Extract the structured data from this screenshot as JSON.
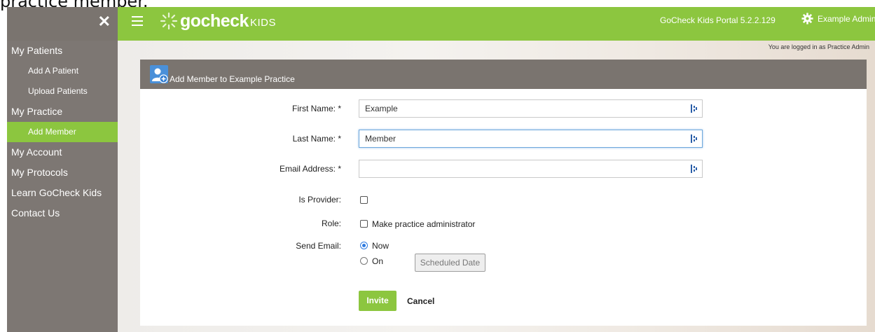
{
  "caption": "practice member.",
  "sidebar": {
    "items": [
      {
        "label": "My Patients"
      },
      {
        "label": "Add A Patient"
      },
      {
        "label": "Upload Patients"
      },
      {
        "label": "My Practice"
      },
      {
        "label": "Add Member"
      },
      {
        "label": "My Account"
      },
      {
        "label": "My Protocols"
      },
      {
        "label": "Learn GoCheck Kids"
      },
      {
        "label": "Contact Us"
      }
    ],
    "active_item": "Add Member"
  },
  "header": {
    "logo_text": "gocheck",
    "logo_kids": "KIDS",
    "version": "GoCheck Kids Portal 5.2.2.129",
    "user": "Example Admin"
  },
  "logged_in_text": "You are logged in as Practice Admin",
  "panel": {
    "title": "Add Member to Example Practice"
  },
  "form": {
    "first_name": {
      "label": "First Name: *",
      "value": "Example"
    },
    "last_name": {
      "label": "Last Name: *",
      "value": "Member"
    },
    "email": {
      "label": "Email Address: *",
      "value": ""
    },
    "is_provider": {
      "label": "Is Provider:",
      "checked": false
    },
    "role": {
      "label": "Role:",
      "option": "Make practice administrator",
      "checked": false
    },
    "send_email": {
      "label": "Send Email:",
      "option_now": "Now",
      "option_on": "On",
      "selected": "Now",
      "scheduled_date": "Scheduled Date"
    },
    "invite": "Invite",
    "cancel": "Cancel"
  },
  "colors": {
    "brand_green": "#8cc63f",
    "sidebar_gray": "#7d7773",
    "panel_head": "#7a746f"
  }
}
